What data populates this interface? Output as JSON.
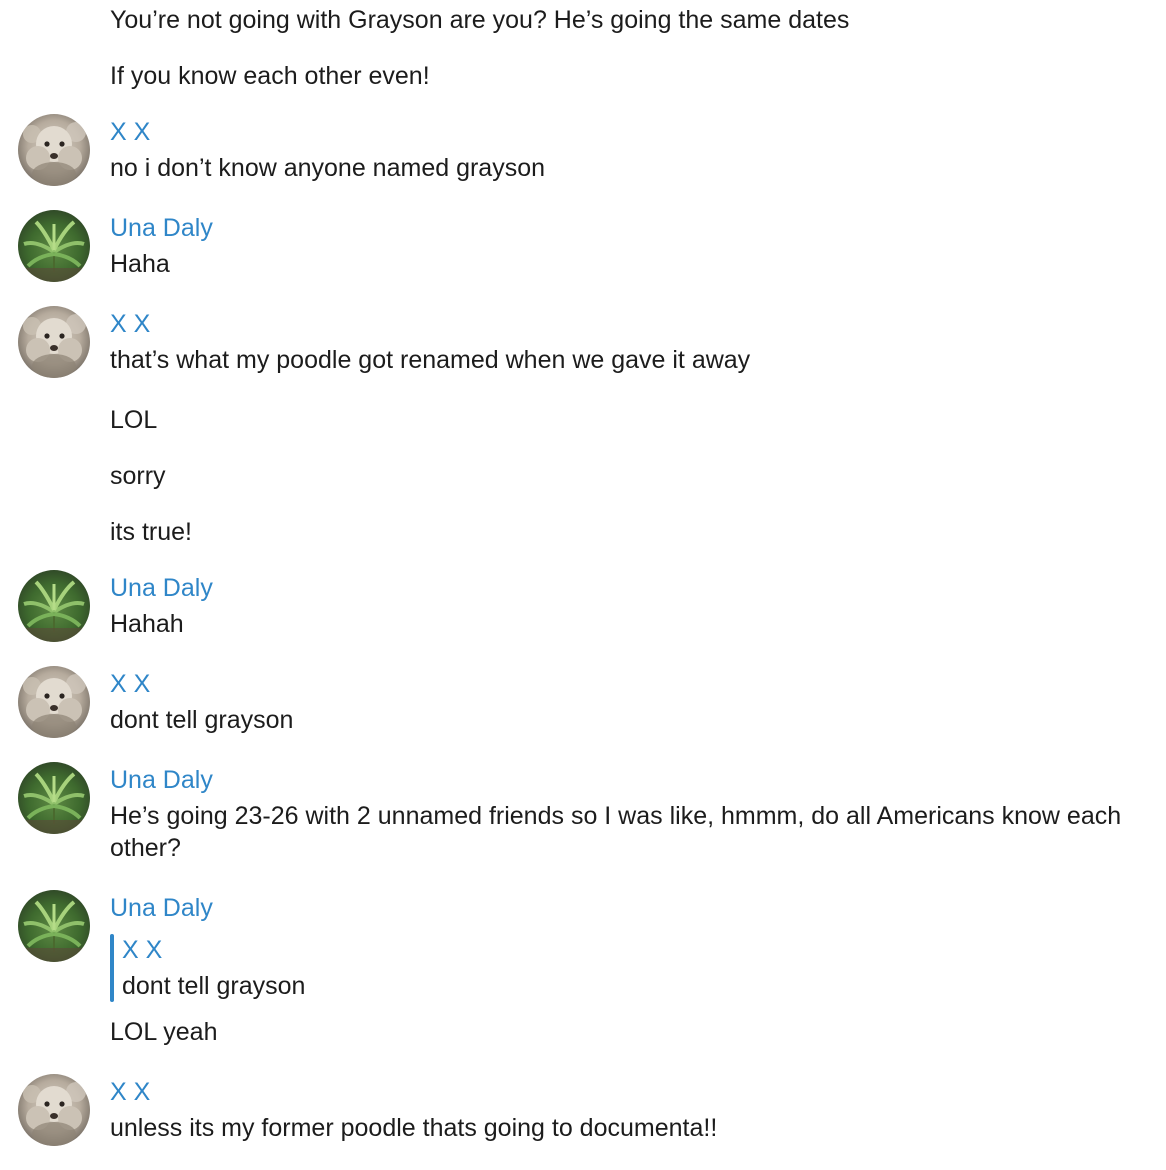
{
  "messages": {
    "m1": "You’re not going with Grayson are you? He’s going the same dates",
    "m2": "If you know each other even!",
    "g1_author": "X X",
    "g1_text": "no i don’t know anyone named grayson",
    "g2_author": "Una Daly",
    "g2_text": "Haha",
    "g3_author": "X X",
    "g3_text1": "that’s what my poodle got renamed when we gave it away",
    "g3_text2": "LOL",
    "g3_text3": "sorry",
    "g3_text4": "its true!",
    "g4_author": "Una Daly",
    "g4_text": "Hahah",
    "g5_author": "X X",
    "g5_text": "dont tell grayson",
    "g6_author": "Una Daly",
    "g6_text": "He’s going 23-26 with 2 unnamed friends so I was like, hmmm, do all Americans know each other?",
    "g7_author": "Una Daly",
    "g7_quote_author": "X X",
    "g7_quote_text": "dont tell grayson",
    "g7_text": "LOL yeah",
    "g8_author": "X X",
    "g8_text": "unless its my former poodle thats going to documenta!!"
  },
  "avatars": {
    "xx": "poodle-avatar",
    "una": "fern-avatar"
  },
  "colors": {
    "author": "#2f86c8",
    "text": "#1c1c1c",
    "quote_bar": "#2f86c8"
  }
}
